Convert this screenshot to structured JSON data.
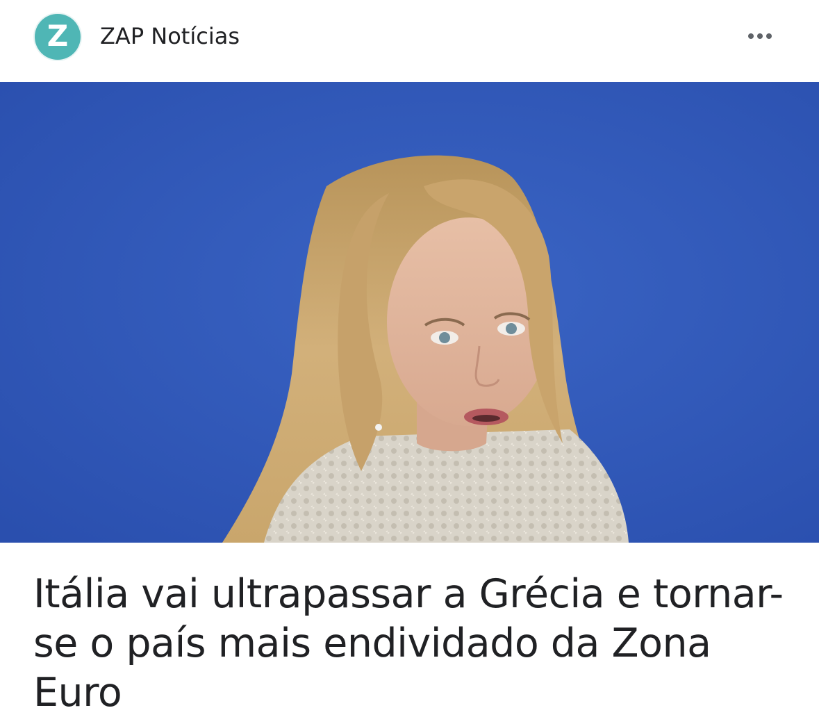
{
  "publisher": {
    "logo_letter": "Z",
    "name": "ZAP Notícias"
  },
  "menu": {
    "icon": "more-horizontal-icon"
  },
  "article": {
    "headline": "Itália vai ultrapassar a Grécia e tornar-se o país mais endividado da Zona Euro"
  },
  "colors": {
    "logo_teal": "#4fb6b5",
    "image_background_blue": "#2f56b4"
  }
}
